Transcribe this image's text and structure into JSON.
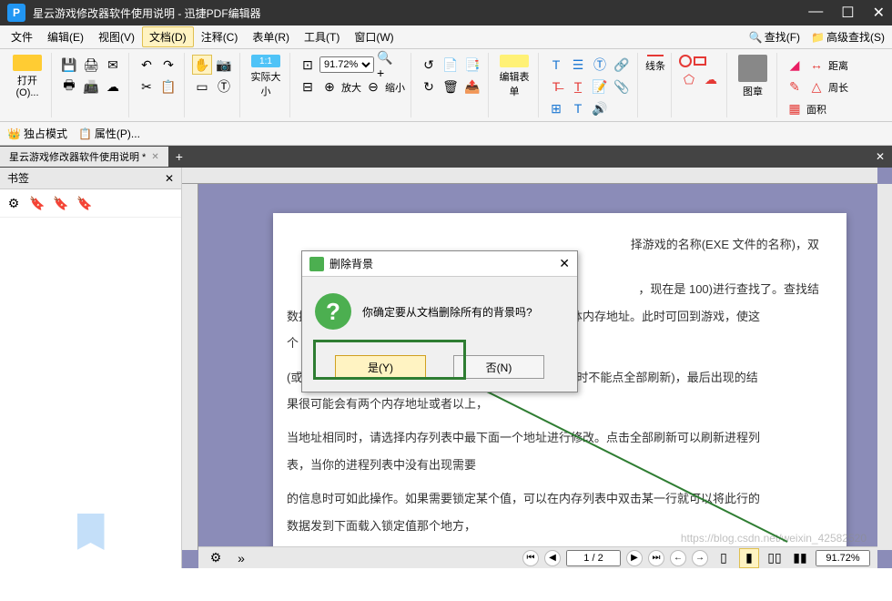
{
  "titlebar": {
    "text": "星云游戏修改器软件使用说明  -  迅捷PDF编辑器",
    "logo": "P"
  },
  "menu": {
    "items": [
      "文件",
      "编辑(E)",
      "视图(V)",
      "文档(D)",
      "注释(C)",
      "表单(R)",
      "工具(T)",
      "窗口(W)"
    ],
    "active_index": 3,
    "search": "查找(F)",
    "adv_search": "高级查找(S)"
  },
  "ribbon": {
    "open": "打开(O)...",
    "actual_size": "实际大小",
    "zoom_in": "放大",
    "zoom_out": "缩小",
    "zoom_value": "91.72%",
    "edit_form": "编辑表单",
    "lines": "线条",
    "stamp": "图章",
    "distance": "距离",
    "perimeter": "周长",
    "area": "面积"
  },
  "subbar": {
    "exclusive": "独占模式",
    "props": "属性(P)..."
  },
  "tab": {
    "title": "星云游戏修改器软件使用说明 *"
  },
  "sidebar": {
    "title": "书签"
  },
  "page": {
    "lines": [
      "择游戏的名称(EXE 文件的名称)，双",
      "，现在是 100)进行查找了。查找结",
      "数据，这时候通常数据都比较多，难以确定要修改的具体内存地址。此时可回到游戏，使这",
      "个 HP 值产生变化，然后用热键 ALT+Q",
      "(或 ALT+TAB)呼出星云，再次输入这个数值进行查找(此时不能点全部刷新)，最后出现的结",
      "果很可能会有两个内存地址或者以上，",
      "当地址相同时，请选择内存列表中最下面一个地址进行修改。点击全部刷新可以刷新进程列",
      "表，当你的进程列表中没有出现需要",
      "的信息时可如此操作。如果需要锁定某个值，可以在内存列表中双击某一行就可以将此行的",
      "数据发到下面载入锁定值那个地方，"
    ]
  },
  "dialog": {
    "title": "删除背景",
    "msg": "你确定要从文档删除所有的背景吗?",
    "yes": "是(Y)",
    "no": "否(N)"
  },
  "status": {
    "page": "1 / 2",
    "zoom": "91.72%"
  },
  "watermark": "https://blog.csdn.net/weixin_42582520"
}
